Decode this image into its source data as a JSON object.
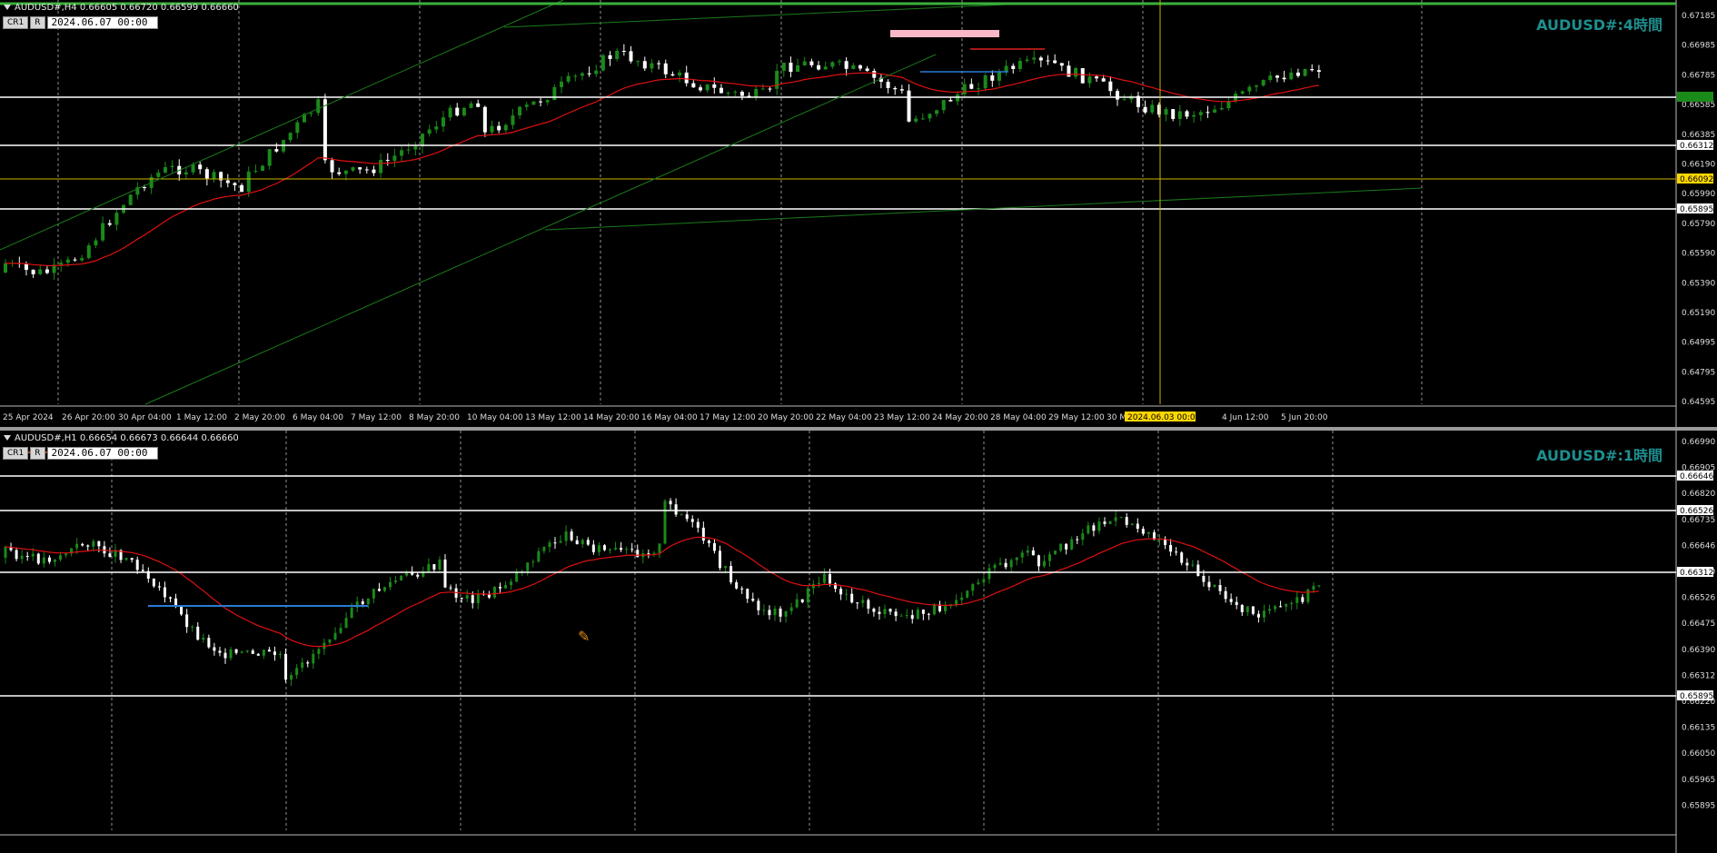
{
  "top": {
    "info": "AUDUSD#,H4  0.66605 0.66720 0.66599 0.66660",
    "btn_cr": "CR1",
    "btn_r": "R",
    "date_input": "2024.06.07 00:00",
    "symbol_title": "AUDUSD#:4時間",
    "price_ticks": [
      "0.67185",
      "0.66985",
      "0.66785",
      "0.66585",
      "0.66385",
      "0.66190",
      "0.65990",
      "0.65790",
      "0.65590",
      "0.65390",
      "0.65190",
      "0.64995",
      "0.64795",
      "0.64595"
    ],
    "time_ticks": [
      "25 Apr 2024",
      "26 Apr 20:00",
      "30 Apr 04:00",
      "1 May 12:00",
      "2 May 20:00",
      "6 May 04:00",
      "7 May 12:00",
      "8 May 20:00",
      "10 May 04:00",
      "13 May 12:00",
      "14 May 20:00",
      "16 May 04:00",
      "17 May 12:00",
      "20 May 20:00",
      "22 May 04:00",
      "23 May 12:00",
      "24 May 20:00",
      "28 May 04:00",
      "29 May 12:00",
      "30 M",
      "4 Jun 12:00",
      "5 Jun 20:00"
    ],
    "crosshair_label": "2024.06.03 00:00",
    "level_labels": [
      {
        "text": "0.66312",
        "color": "#ffffff",
        "bg": "#ffffff",
        "fg": "#000000"
      },
      {
        "text": "0.66092",
        "color": "#ffd700",
        "bg": "#ffd700",
        "fg": "#000000"
      },
      {
        "text": "0.65895",
        "color": "#ffffff",
        "bg": "#ffffff",
        "fg": "#000000"
      }
    ]
  },
  "bottom": {
    "info": "AUDUSD#,H1  0.66654 0.66673 0.66644 0.66660",
    "btn_cr": "CR1",
    "btn_r": "R",
    "date_input": "2024.06.07 00:00",
    "symbol_title": "AUDUSD#:1時間",
    "price_ticks": [
      "0.66990",
      "0.66905",
      "0.66820",
      "0.66735",
      "0.66646",
      "0.66560",
      "0.66526",
      "0.66475",
      "0.66390",
      "0.66312",
      "0.66220",
      "0.66135",
      "0.66050",
      "0.65965",
      "0.65895"
    ],
    "level_labels": [
      {
        "text": "0.66646",
        "color": "#ffffff",
        "bg": "#ffffff",
        "fg": "#000000"
      },
      {
        "text": "0.66526",
        "color": "#ffffff",
        "bg": "#ffffff",
        "fg": "#000000"
      },
      {
        "text": "0.66312",
        "color": "#ffffff",
        "bg": "#ffffff",
        "fg": "#000000"
      },
      {
        "text": "0.65895",
        "color": "#ffffff",
        "bg": "#ffffff",
        "fg": "#000000"
      }
    ]
  },
  "colors": {
    "bull": "#1a8a1a",
    "bear": "#ffffff",
    "ma": "#e01010",
    "zigzag": "#e0a000",
    "trend": "#1a7a1a",
    "grid": "#cfcfcf",
    "accent_title": "#1e8f8f"
  }
}
